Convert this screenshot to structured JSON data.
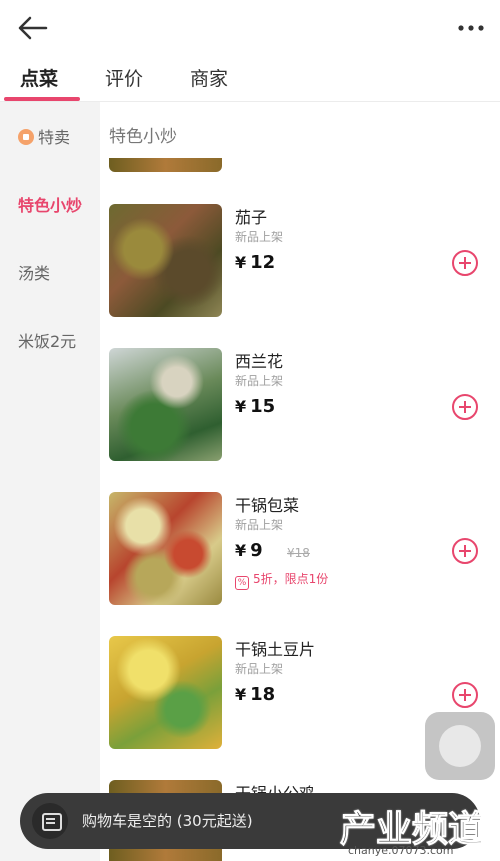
{
  "header": {
    "title": "",
    "back_icon": "arrow-left-icon",
    "more_icon": "more-dots-icon"
  },
  "tabs": [
    {
      "label": "点菜",
      "active": true
    },
    {
      "label": "评价",
      "active": false
    },
    {
      "label": "商家",
      "active": false
    }
  ],
  "sidebar": {
    "items": [
      {
        "label": "特卖",
        "icon": "discount-badge-icon",
        "active": false
      },
      {
        "label": "特色小炒",
        "active": true
      },
      {
        "label": "汤类",
        "active": false
      },
      {
        "label": "米饭2元",
        "active": false
      }
    ]
  },
  "section_title": "特色小炒",
  "dishes": [
    {
      "name": "茄子",
      "tag": "新品上架",
      "currency": "¥",
      "price": "12"
    },
    {
      "name": "西兰花",
      "tag": "新品上架",
      "currency": "¥",
      "price": "15"
    },
    {
      "name": "干锅包菜",
      "tag": "新品上架",
      "currency": "¥",
      "price": "9",
      "original_price": "¥18",
      "promo": "5折，限点1份"
    },
    {
      "name": "干锅土豆片",
      "tag": "新品上架",
      "currency": "¥",
      "price": "18"
    },
    {
      "name": "干锅小公鸡"
    }
  ],
  "cart": {
    "text": "购物车是空的 (30元起送)",
    "icon": "cart-icon"
  },
  "watermark": {
    "main": "产业频道",
    "sub": "chanye.07073.com"
  },
  "colors": {
    "accent": "#e8466d",
    "cart_bar": "#3a3a3a"
  }
}
